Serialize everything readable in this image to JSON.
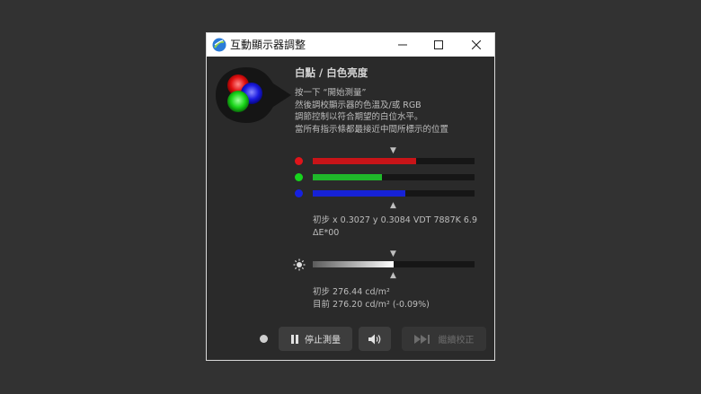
{
  "window": {
    "title": "互動顯示器調整",
    "controls": {
      "minimize": "—",
      "maximize": "☐",
      "close": "✕"
    }
  },
  "header": {
    "title": "白點 / 白色亮度",
    "instructions": [
      "按一下 “開始測量”",
      "然後調校顯示器的色溫及/或 RGB",
      "調節控制以符合期望的白位水平。",
      "當所有指示條都最接近中間所標示的位置"
    ]
  },
  "rgb_bars": [
    {
      "name": "red",
      "color": "#e0141a",
      "fill_color": "#c81418",
      "value": 0.64
    },
    {
      "name": "green",
      "color": "#17d41d",
      "fill_color": "#1fb82a",
      "value": 0.43
    },
    {
      "name": "blue",
      "color": "#1621e0",
      "fill_color": "#1622d6",
      "value": 0.57
    }
  ],
  "rgb_reading": {
    "line1": "初步 x 0.3027 y 0.3084 VDT 7887K 6.9",
    "line2": "ΔE*00"
  },
  "luminance_bar": {
    "value": 0.5
  },
  "luminance_reading": {
    "initial": "初步 276.44 cd/m²",
    "current": "目前 276.20 cd/m² (-0.09%)"
  },
  "buttons": {
    "stop_label": "停止測量",
    "continue_label": "繼續校正"
  },
  "icons": {
    "logo": "rgb-circles-icon",
    "pause": "pause-icon",
    "speaker": "speaker-icon",
    "skip": "skip-forward-icon",
    "sun": "brightness-icon",
    "marker_down": "▼",
    "marker_up": "▲"
  }
}
